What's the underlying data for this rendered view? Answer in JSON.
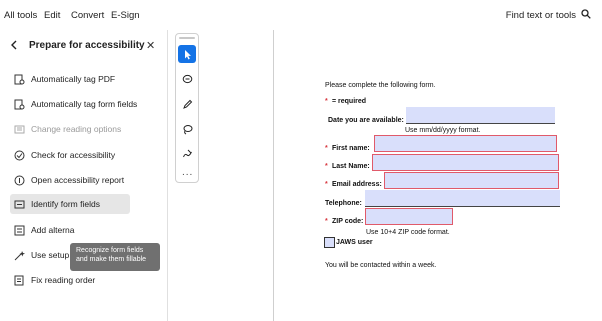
{
  "topbar": {
    "menus": [
      "All tools",
      "Edit",
      "Convert",
      "E-Sign"
    ],
    "find_label": "Find text or tools"
  },
  "panel": {
    "title": "Prepare for accessibility",
    "tools": [
      {
        "label": "Automatically tag PDF",
        "icon": "tag-pdf-icon",
        "state": "normal"
      },
      {
        "label": "Automatically tag form fields",
        "icon": "tag-form-icon",
        "state": "normal"
      },
      {
        "label": "Change reading options",
        "icon": "reading-options-icon",
        "state": "disabled"
      },
      {
        "label": "Check for accessibility",
        "icon": "accessibility-check-icon",
        "state": "normal"
      },
      {
        "label": "Open accessibility report",
        "icon": "report-icon",
        "state": "normal"
      },
      {
        "label": "Identify form fields",
        "icon": "identify-fields-icon",
        "state": "active"
      },
      {
        "label": "Add alterna",
        "icon": "alt-text-icon",
        "state": "normal"
      },
      {
        "label": "Use setup assistant",
        "icon": "setup-assistant-icon",
        "state": "normal"
      },
      {
        "label": "Fix reading order",
        "icon": "reading-order-icon",
        "state": "normal"
      }
    ],
    "tooltip": "Recognize form fields and make them fillable"
  },
  "toolstrip": {
    "tools": [
      "select-cursor-icon",
      "comment-icon",
      "pen-icon",
      "lasso-icon",
      "sign-icon"
    ],
    "more": "..."
  },
  "document": {
    "intro": "Please complete the following form.",
    "required_star": "*",
    "required_note": "= required",
    "date_label": "Date you are available:",
    "date_hint": "Use mm/dd/yyyy format.",
    "first_name_label": "First name:",
    "last_name_label": "Last Name:",
    "email_label": "Email address:",
    "telephone_label": "Telephone:",
    "zip_label": "ZIP code:",
    "zip_hint": "Use 10+4 ZIP code format.",
    "jaws_label": "JAWS user",
    "footer": "You will be contacted within a week."
  },
  "colors": {
    "accent": "#1473e6",
    "field_fill": "#d9dffb",
    "error_border": "#e05a6a",
    "required": "#d7373f"
  }
}
